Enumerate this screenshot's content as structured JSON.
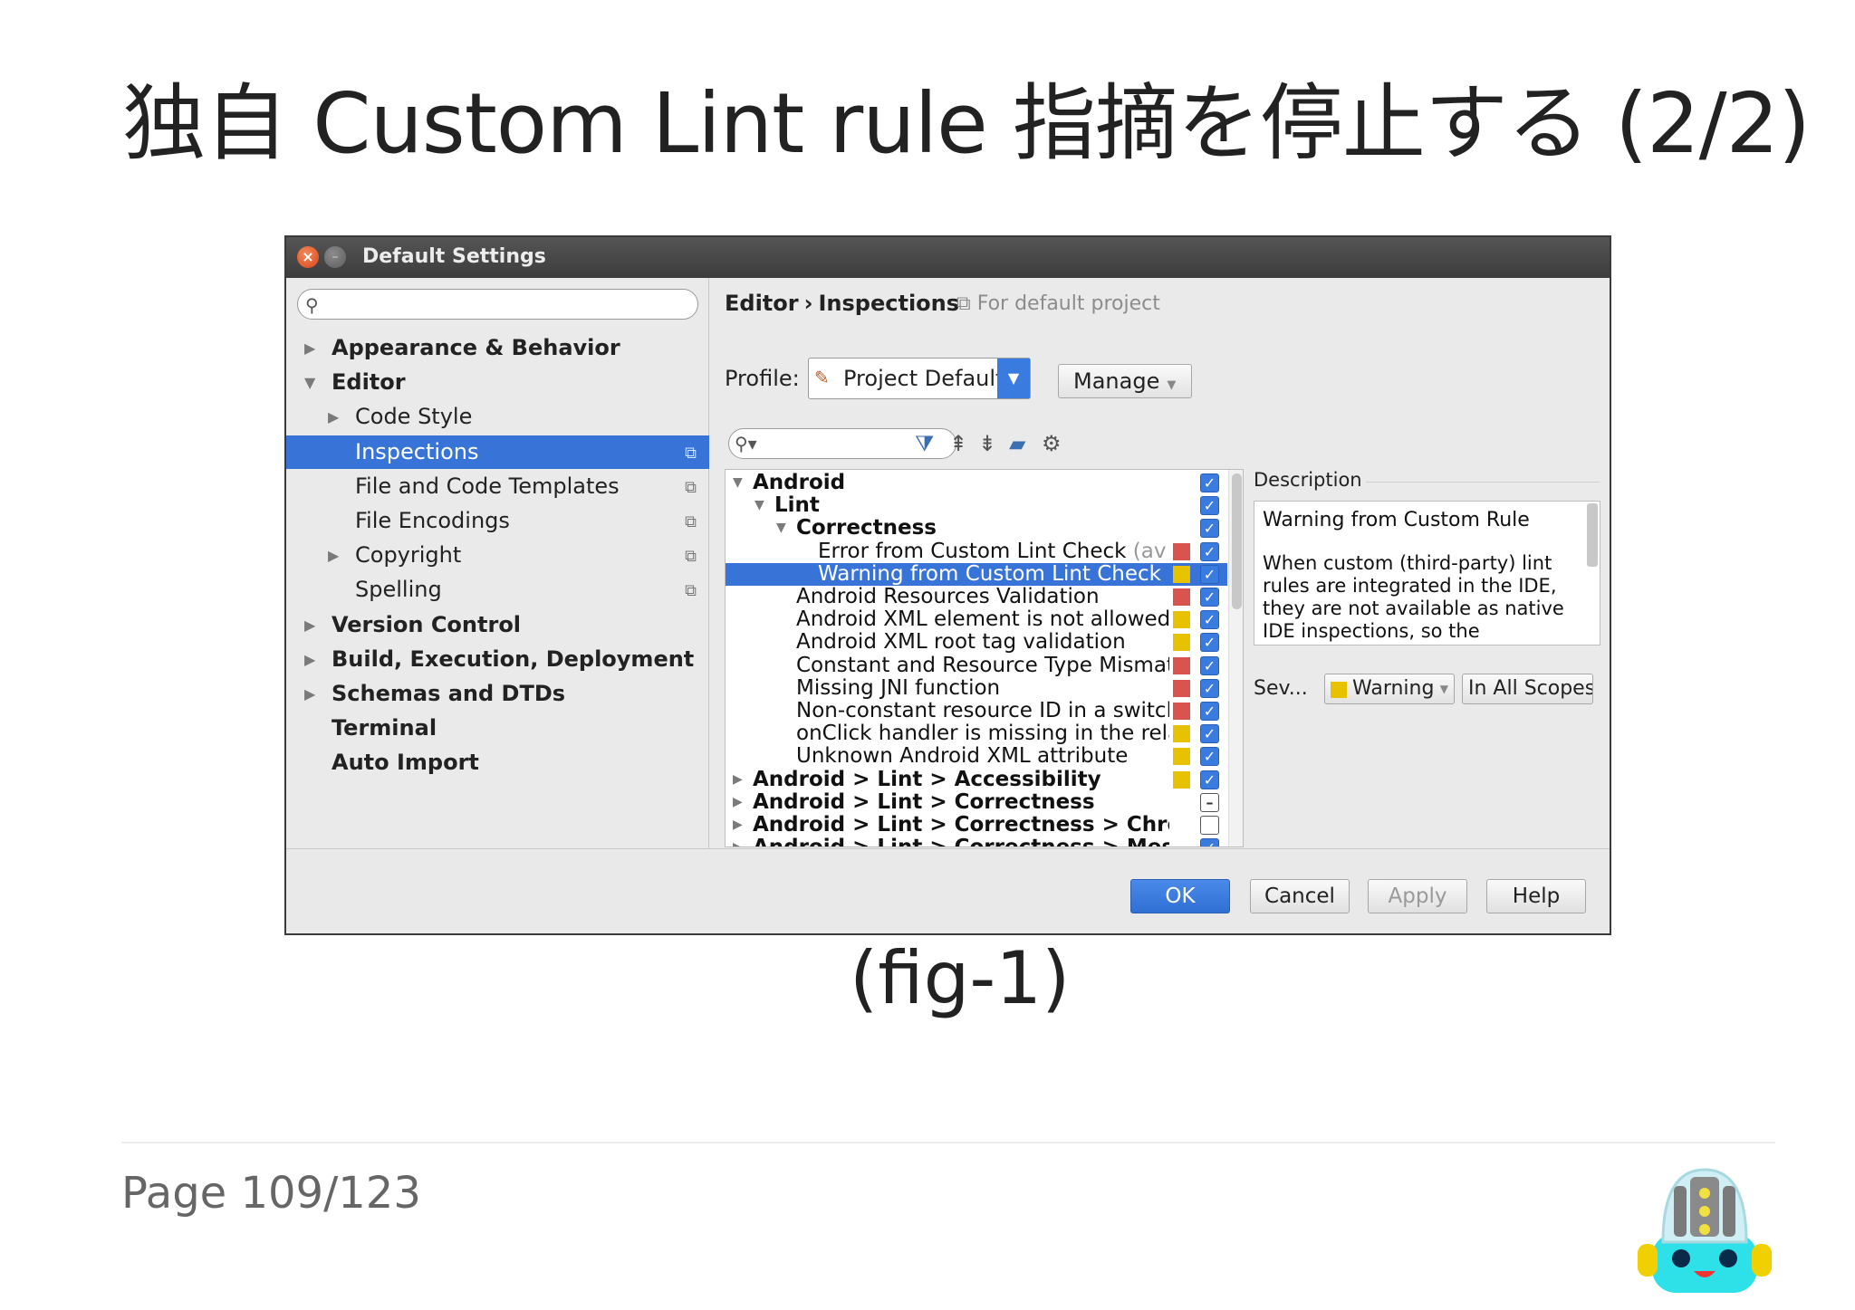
{
  "slide": {
    "title": "独自 Custom Lint rule 指摘を停止する (2/2)",
    "caption": "(fig-1)",
    "page": "Page 109/123"
  },
  "dialog": {
    "title": "Default Settings",
    "sidebar": [
      {
        "label": "Appearance & Behavior",
        "bold": true,
        "arrow": "▶",
        "indent": 0
      },
      {
        "label": "Editor",
        "bold": true,
        "arrow": "▼",
        "indent": 0
      },
      {
        "label": "Code Style",
        "bold": false,
        "arrow": "▶",
        "indent": 1
      },
      {
        "label": "Inspections",
        "bold": false,
        "arrow": "",
        "indent": 1,
        "selected": true,
        "copy": true
      },
      {
        "label": "File and Code Templates",
        "bold": false,
        "arrow": "",
        "indent": 1,
        "copy": true
      },
      {
        "label": "File Encodings",
        "bold": false,
        "arrow": "",
        "indent": 1,
        "copy": true
      },
      {
        "label": "Copyright",
        "bold": false,
        "arrow": "▶",
        "indent": 1,
        "copy": true
      },
      {
        "label": "Spelling",
        "bold": false,
        "arrow": "",
        "indent": 1,
        "copy": true
      },
      {
        "label": "Version Control",
        "bold": true,
        "arrow": "▶",
        "indent": 0
      },
      {
        "label": "Build, Execution, Deployment",
        "bold": true,
        "arrow": "▶",
        "indent": 0
      },
      {
        "label": "Schemas and DTDs",
        "bold": true,
        "arrow": "▶",
        "indent": 0
      },
      {
        "label": "Terminal",
        "bold": true,
        "arrow": "",
        "indent": 0
      },
      {
        "label": "Auto Import",
        "bold": true,
        "arrow": "",
        "indent": 0
      }
    ],
    "breadcrumb": {
      "first": "Editor",
      "sep": "›",
      "second": "Inspections",
      "sub": "For default project"
    },
    "profile": {
      "label": "Profile:",
      "value": "Project Default",
      "manage": "Manage"
    },
    "inspections": [
      {
        "label": "Android",
        "level": 0,
        "bold": true,
        "arrow": "▼",
        "severity": "",
        "check": "on"
      },
      {
        "label": "Lint",
        "level": 1,
        "bold": true,
        "arrow": "▼",
        "severity": "",
        "check": "on"
      },
      {
        "label": "Correctness",
        "level": 2,
        "bold": true,
        "arrow": "▼",
        "severity": "",
        "check": "on"
      },
      {
        "label": "Error from Custom Lint Check",
        "suffix": " (av",
        "level": 3,
        "bold": false,
        "arrow": "",
        "severity": "error",
        "check": "on"
      },
      {
        "label": "Warning from Custom Lint Check",
        "level": 3,
        "bold": false,
        "arrow": "",
        "severity": "warning",
        "check": "on",
        "selected": true
      },
      {
        "label": "Android Resources Validation",
        "level": 2,
        "bold": false,
        "arrow": "",
        "severity": "error",
        "check": "on"
      },
      {
        "label": "Android XML element is not allowed",
        "level": 2,
        "bold": false,
        "arrow": "",
        "severity": "warning",
        "check": "on"
      },
      {
        "label": "Android XML root tag validation",
        "level": 2,
        "bold": false,
        "arrow": "",
        "severity": "warning",
        "check": "on"
      },
      {
        "label": "Constant and Resource Type Mismatch",
        "level": 2,
        "bold": false,
        "arrow": "",
        "severity": "error",
        "check": "on"
      },
      {
        "label": "Missing JNI function",
        "level": 2,
        "bold": false,
        "arrow": "",
        "severity": "error",
        "check": "on"
      },
      {
        "label": "Non-constant resource ID in a switch st",
        "level": 2,
        "bold": false,
        "arrow": "",
        "severity": "error",
        "check": "on"
      },
      {
        "label": "onClick handler is missing in the relate",
        "level": 2,
        "bold": false,
        "arrow": "",
        "severity": "warning",
        "check": "on"
      },
      {
        "label": "Unknown Android XML attribute",
        "level": 2,
        "bold": false,
        "arrow": "",
        "severity": "warning",
        "check": "on"
      },
      {
        "label": "Android > Lint > Accessibility",
        "level": 0,
        "bold": true,
        "arrow": "▶",
        "severity": "warning",
        "check": "on"
      },
      {
        "label": "Android > Lint > Correctness",
        "level": 0,
        "bold": true,
        "arrow": "▶",
        "severity": "",
        "check": "partial"
      },
      {
        "label": "Android > Lint > Correctness > Chrome",
        "level": 0,
        "bold": true,
        "arrow": "▶",
        "severity": "",
        "check": "off"
      },
      {
        "label": "Android > Lint > Correctness > Messages",
        "level": 0,
        "bold": true,
        "arrow": "▶",
        "severity": "",
        "check": "on"
      }
    ],
    "description": {
      "label": "Description",
      "title": "Warning from Custom Rule",
      "body": "When custom (third-party) lint rules are integrated in the IDE, they are not available as native IDE inspections, so the"
    },
    "severity": {
      "label": "Sev...",
      "value": "Warning",
      "scope": "In All Scopes"
    },
    "buttons": {
      "ok": "OK",
      "cancel": "Cancel",
      "apply": "Apply",
      "help": "Help"
    }
  },
  "colors": {
    "selection": "#3874d8",
    "error": "#d9534f",
    "warning": "#e6c200",
    "checkbox": "#3a7be0"
  }
}
